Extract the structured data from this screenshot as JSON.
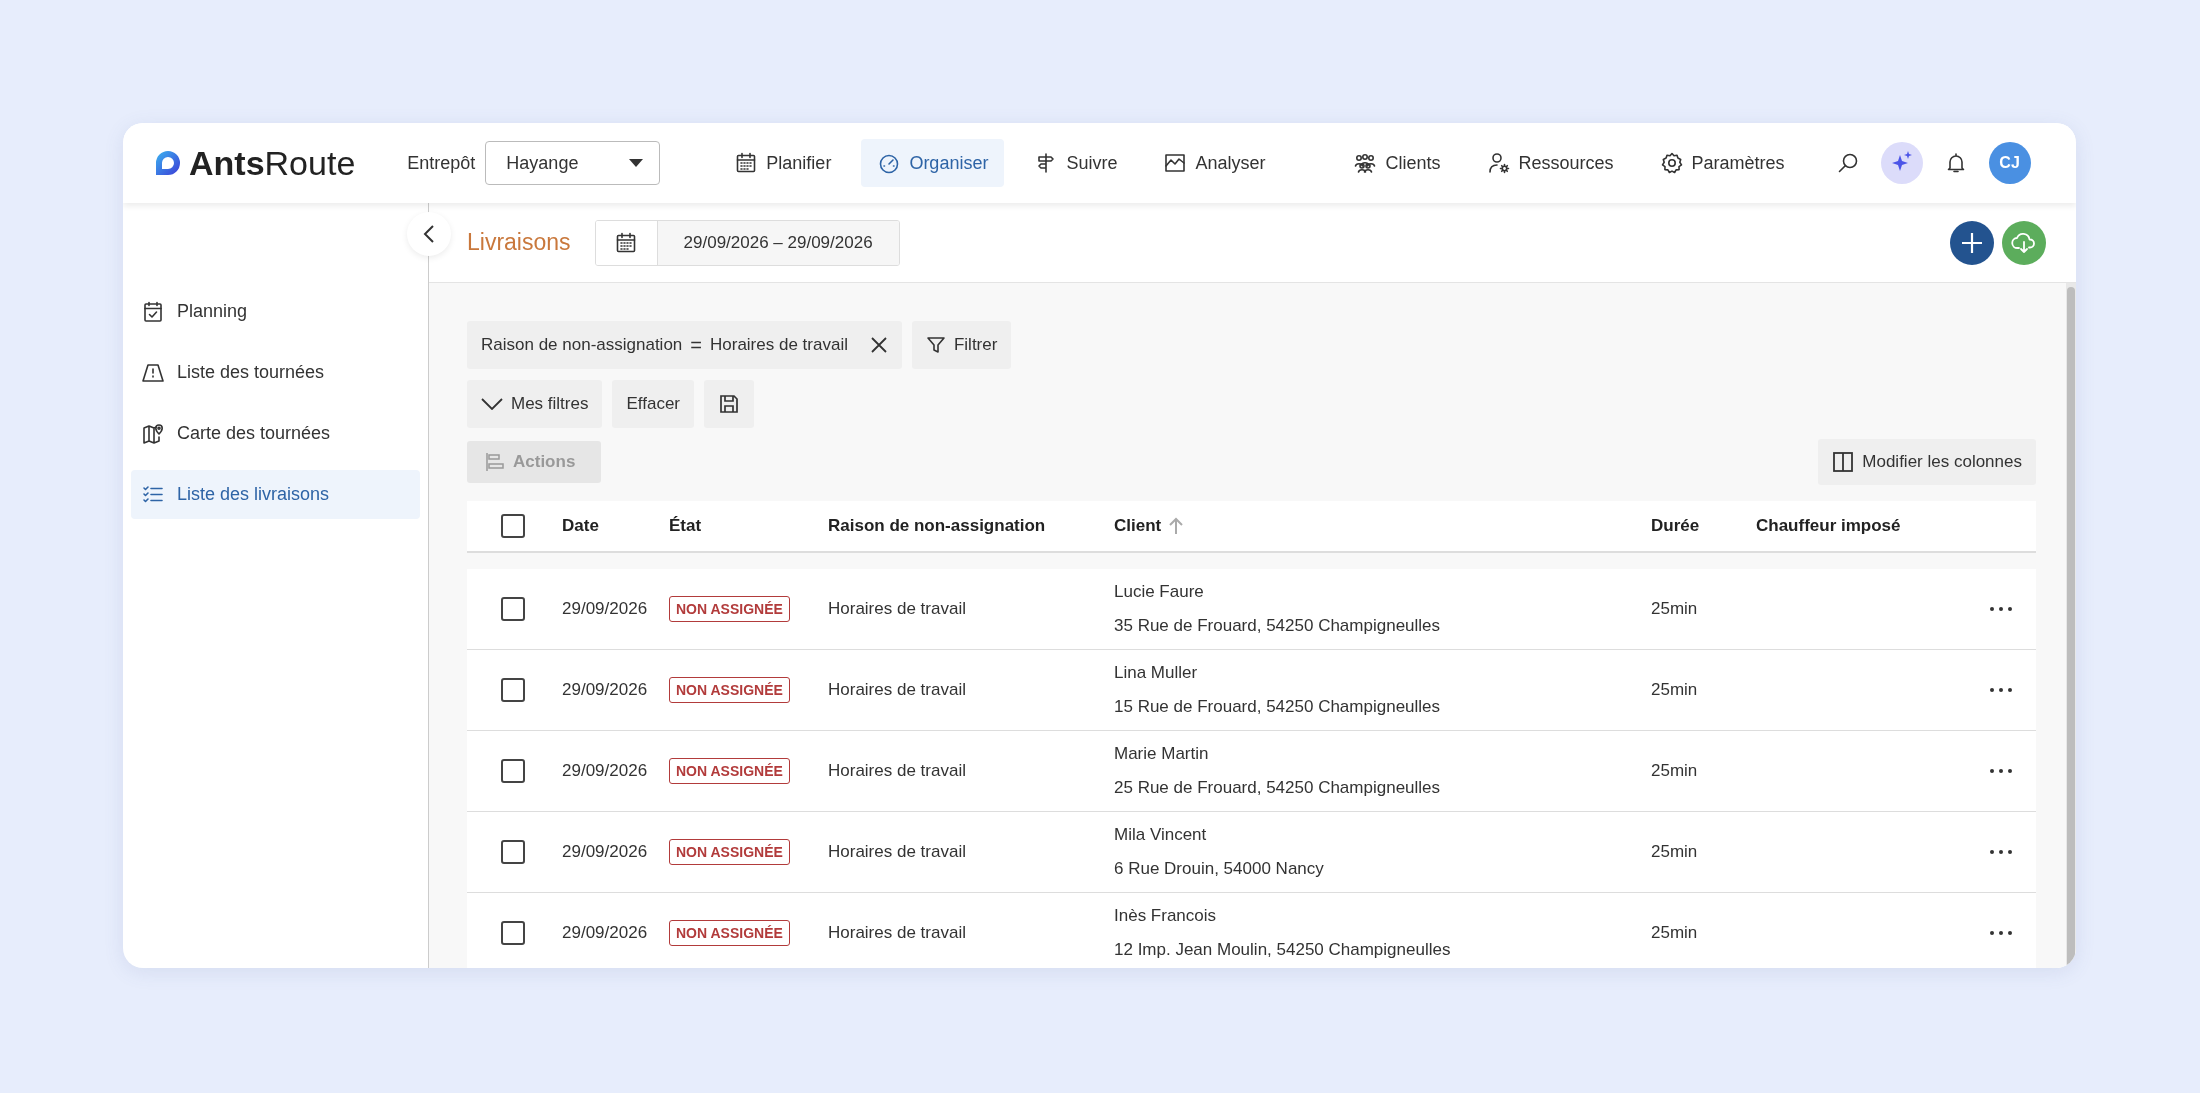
{
  "topbar": {
    "logo": "**Ants**Route",
    "warehouse": {
      "label": "Entrepôt",
      "value": "Hayange"
    },
    "nav": [
      {
        "label": "Planifier",
        "selected": false
      },
      {
        "label": "Organiser",
        "selected": true
      },
      {
        "label": "Suivre",
        "selected": false
      },
      {
        "label": "Analyser",
        "selected": false
      }
    ],
    "nav_right": [
      {
        "label": "Clients",
        "selected": false
      },
      {
        "label": "Ressources",
        "selected": false
      },
      {
        "label": "Paramètres",
        "selected": false
      }
    ],
    "avatar": "CJ"
  },
  "sidebar": {
    "items": [
      {
        "label": "Planning",
        "selected": false
      },
      {
        "label": "Liste des tournées",
        "selected": false
      },
      {
        "label": "Carte des tournées",
        "selected": false
      },
      {
        "label": "Liste des livraisons",
        "selected": true
      }
    ]
  },
  "page": {
    "title": "Livraisons",
    "date_range": "29/09/2026 – 29/09/2026"
  },
  "filters": {
    "active": {
      "field": "Raison de non-assignation",
      "operator": "=",
      "value": "Horaires de travail"
    },
    "filter_button": "Filtrer",
    "my_filters": "Mes filtres",
    "clear": "Effacer",
    "actions": {
      "label": "Actions",
      "disabled": true
    },
    "columns_button": "Modifier les colonnes"
  },
  "table": {
    "select_all": {
      "checked": false
    },
    "columns": [
      {
        "label": "Date"
      },
      {
        "label": "État"
      },
      {
        "label": "Raison de non-assignation"
      },
      {
        "label": "Client",
        "sorted_ascending": true
      },
      {
        "label": "Durée"
      },
      {
        "label": "Chauffeur imposé"
      }
    ],
    "rows": [
      {
        "checked": false,
        "date": "29/09/2026",
        "status": {
          "label": "NON ASSIGNÉE",
          "kind": "unassigned"
        },
        "reason": "Horaires de travail",
        "client": "Lucie Faure",
        "address": "35 Rue de Frouard, 54250 Champigneulles",
        "duration": "25min"
      },
      {
        "checked": false,
        "date": "29/09/2026",
        "status": {
          "label": "NON ASSIGNÉE",
          "kind": "unassigned"
        },
        "reason": "Horaires de travail",
        "client": "Lina Muller",
        "address": "15 Rue de Frouard, 54250 Champigneulles",
        "duration": "25min"
      },
      {
        "checked": false,
        "date": "29/09/2026",
        "status": {
          "label": "NON ASSIGNÉE",
          "kind": "unassigned"
        },
        "reason": "Horaires de travail",
        "client": "Marie Martin",
        "address": "25 Rue de Frouard, 54250 Champigneulles",
        "duration": "25min"
      },
      {
        "checked": false,
        "date": "29/09/2026",
        "status": {
          "label": "NON ASSIGNÉE",
          "kind": "unassigned"
        },
        "reason": "Horaires de travail",
        "client": "Mila Vincent",
        "address": "6 Rue Drouin, 54000 Nancy",
        "duration": "25min"
      },
      {
        "checked": false,
        "date": "29/09/2026",
        "status": {
          "label": "NON ASSIGNÉE",
          "kind": "unassigned"
        },
        "reason": "Horaires de travail",
        "client": "Inès Francois",
        "address": "12 Imp. Jean Moulin, 54250 Champigneulles",
        "duration": "25min"
      }
    ]
  }
}
